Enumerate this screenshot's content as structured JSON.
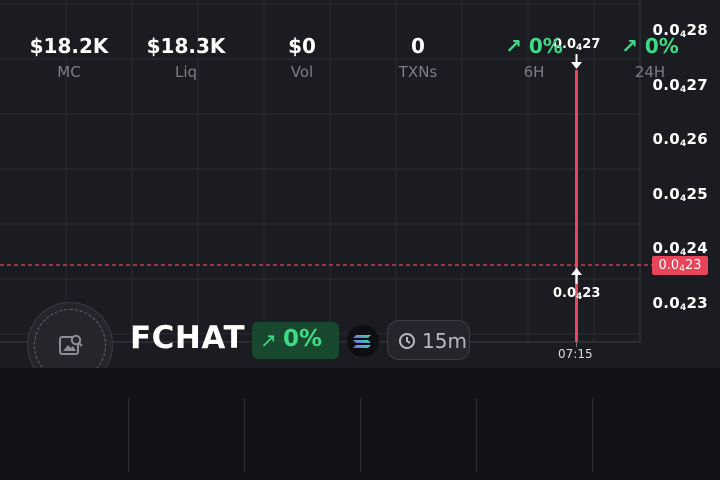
{
  "chart": {
    "y_labels": [
      {
        "pre": "0.0",
        "sub": "4",
        "post": "28"
      },
      {
        "pre": "0.0",
        "sub": "4",
        "post": "27"
      },
      {
        "pre": "0.0",
        "sub": "4",
        "post": "26"
      },
      {
        "pre": "0.0",
        "sub": "4",
        "post": "25"
      },
      {
        "pre": "0.0",
        "sub": "4",
        "post": "24"
      },
      {
        "pre": "0.0",
        "sub": "4",
        "post": "23"
      }
    ],
    "current_price": {
      "pre": "0.0",
      "sub": "4",
      "post": "23"
    },
    "high_marker": {
      "pre": "0.0",
      "sub": "4",
      "post": "27"
    },
    "low_marker": {
      "pre": "0.0",
      "sub": "4",
      "post": "23"
    },
    "time_label": "07:15",
    "accent_color": "#e8445a"
  },
  "token": {
    "name": "FCHAT",
    "change": "0%",
    "change_icon": "arrow-up-right-icon",
    "chain_icon": "solana-icon",
    "interval": "15m"
  },
  "stats": [
    {
      "value": "$18.2K",
      "label": "MC"
    },
    {
      "value": "$18.3K",
      "label": "Liq"
    },
    {
      "value": "$0",
      "label": "Vol"
    },
    {
      "value": "0",
      "label": "TXNs"
    },
    {
      "value": "0%",
      "label": "6H",
      "positive": true
    },
    {
      "value": "0%",
      "label": "24H",
      "positive": true
    }
  ]
}
